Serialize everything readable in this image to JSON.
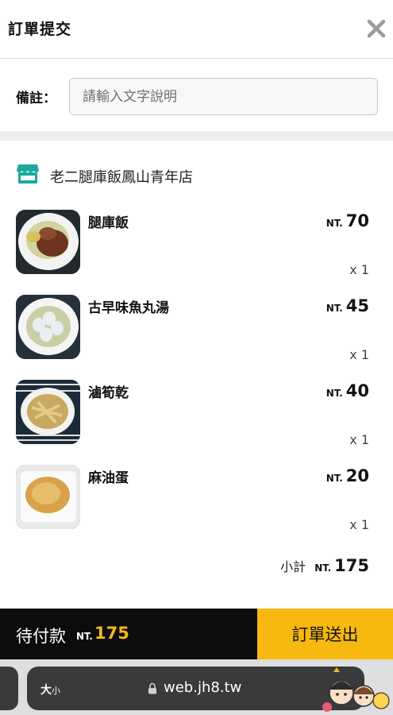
{
  "header": {
    "title": "訂單提交",
    "close_icon": "close-icon"
  },
  "note": {
    "label": "備註：",
    "placeholder": "請輸入文字說明",
    "value": ""
  },
  "store": {
    "icon": "store-icon",
    "name": "老二腿庫飯鳳山青年店",
    "accent_color": "#1aa99b"
  },
  "currency_prefix": "NT.",
  "items": [
    {
      "name": "腿庫飯",
      "price": "70",
      "qty": "x 1"
    },
    {
      "name": "古早味魚丸湯",
      "price": "45",
      "qty": "x 1"
    },
    {
      "name": "滷筍乾",
      "price": "40",
      "qty": "x 1"
    },
    {
      "name": "麻油蛋",
      "price": "20",
      "qty": "x 1"
    }
  ],
  "subtotal": {
    "label": "小計",
    "value": "175"
  },
  "footer": {
    "pay_label": "待付款",
    "pay_amount": "175",
    "submit_label": "訂單送出",
    "colors": {
      "bar": "#0c0c0c",
      "amount": "#f5b81a",
      "submit": "#f7b90f"
    }
  },
  "browser": {
    "size_label_big": "大",
    "size_label_small": "小",
    "url": "web.jh8.tw"
  }
}
